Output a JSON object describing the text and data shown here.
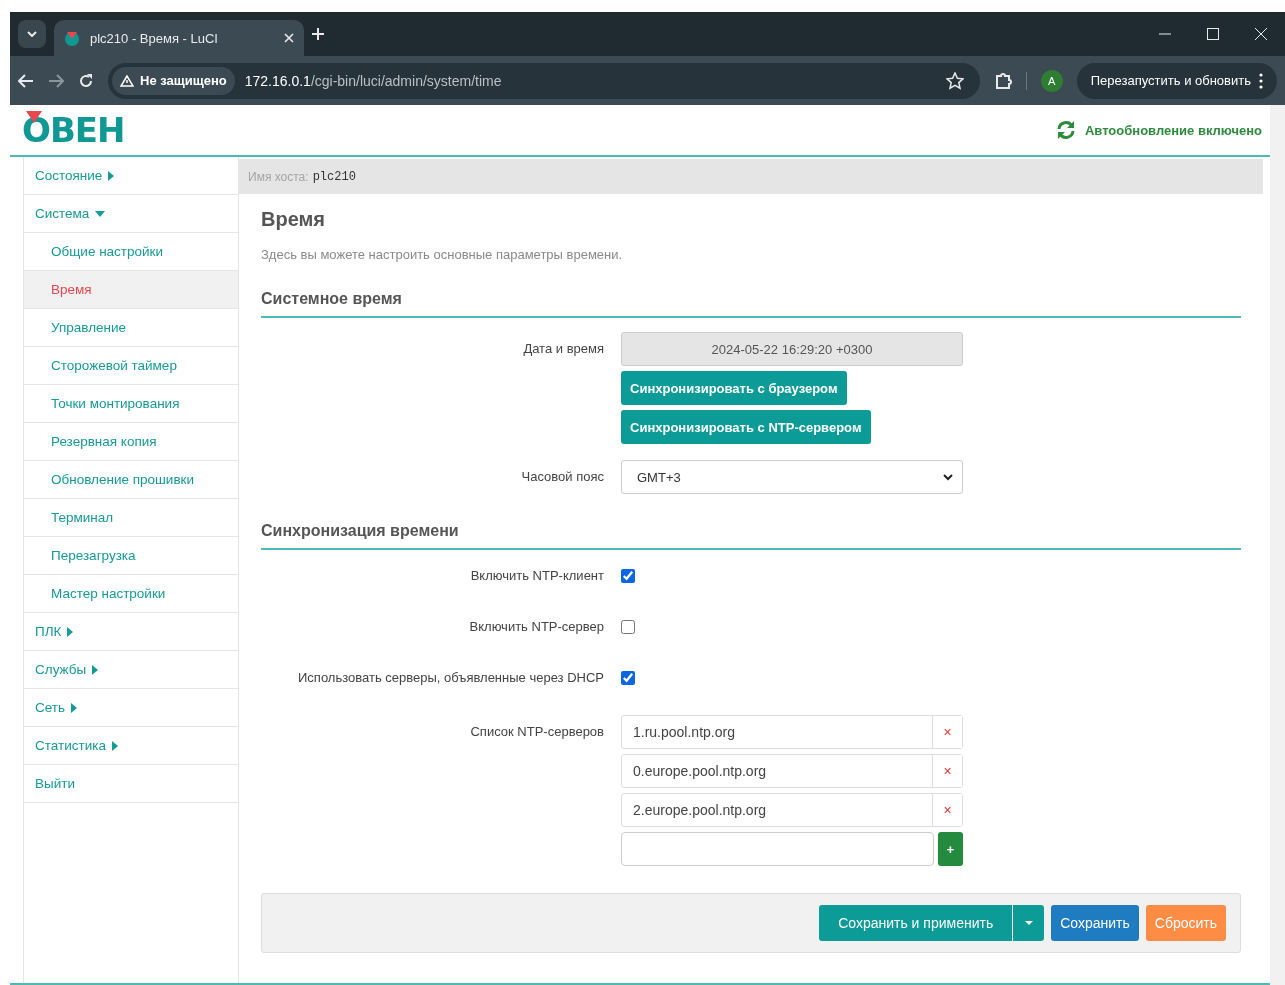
{
  "browser": {
    "tab_title": "plc210 - Время - LuCI",
    "security": "Не защищено",
    "url_host": "172.16.0.1",
    "url_path": "/cgi-bin/luci/admin/system/time",
    "profile_initial": "A",
    "update_button": "Перезапустить и обновить"
  },
  "header": {
    "logo": "ОВЕН",
    "autorefresh": "Автообновление включено"
  },
  "sidebar": [
    {
      "label": "Состояние",
      "kind": "menu",
      "expanded": false,
      "selected": false
    },
    {
      "label": "Система",
      "kind": "menu",
      "expanded": true,
      "selected": false,
      "children": [
        {
          "label": "Общие настройки",
          "selected": false
        },
        {
          "label": "Время",
          "selected": true
        },
        {
          "label": "Управление",
          "selected": false
        },
        {
          "label": "Сторожевой таймер",
          "selected": false
        },
        {
          "label": "Точки монтирования",
          "selected": false
        },
        {
          "label": "Резервная копия",
          "selected": false
        },
        {
          "label": "Обновление прошивки",
          "selected": false
        },
        {
          "label": "Терминал",
          "selected": false
        },
        {
          "label": "Перезагрузка",
          "selected": false
        },
        {
          "label": "Мастер настройки",
          "selected": false
        }
      ]
    },
    {
      "label": "ПЛК",
      "kind": "menu",
      "expanded": false,
      "selected": false
    },
    {
      "label": "Службы",
      "kind": "menu",
      "expanded": false,
      "selected": false
    },
    {
      "label": "Сеть",
      "kind": "menu",
      "expanded": false,
      "selected": false
    },
    {
      "label": "Статистика",
      "kind": "menu",
      "expanded": false,
      "selected": false
    },
    {
      "label": "Выйти",
      "kind": "link",
      "selected": false
    }
  ],
  "hostbar": {
    "label": "Имя хоста:",
    "value": "plc210"
  },
  "title": "Время",
  "description": "Здесь вы можете настроить основные параметры времени.",
  "sections": [
    {
      "title": "Системное время",
      "fields": [
        {
          "kind": "datetime",
          "label": "Дата и время",
          "value": "2024-05-22 16:29:20 +0300",
          "buttons": [
            "Синхронизировать с браузером",
            "Синхронизировать с NTP-сервером"
          ]
        },
        {
          "kind": "select",
          "label": "Часовой пояс",
          "value": "GMT+3"
        }
      ]
    },
    {
      "title": "Синхронизация времени",
      "fields": [
        {
          "kind": "checkbox",
          "label": "Включить NTP-клиент",
          "checked": true
        },
        {
          "kind": "checkbox",
          "label": "Включить NTP-сервер",
          "checked": false
        },
        {
          "kind": "checkbox",
          "label": "Использовать серверы, объявленные через DHCP",
          "checked": true
        },
        {
          "kind": "list",
          "label": "Список NTP-серверов",
          "values": [
            "1.ru.pool.ntp.org",
            "0.europe.pool.ntp.org",
            "2.europe.pool.ntp.org"
          ],
          "remove": "×",
          "add": "+"
        }
      ]
    }
  ],
  "actions": {
    "save_apply": "Сохранить и применить",
    "save": "Сохранить",
    "reset": "Сбросить"
  }
}
